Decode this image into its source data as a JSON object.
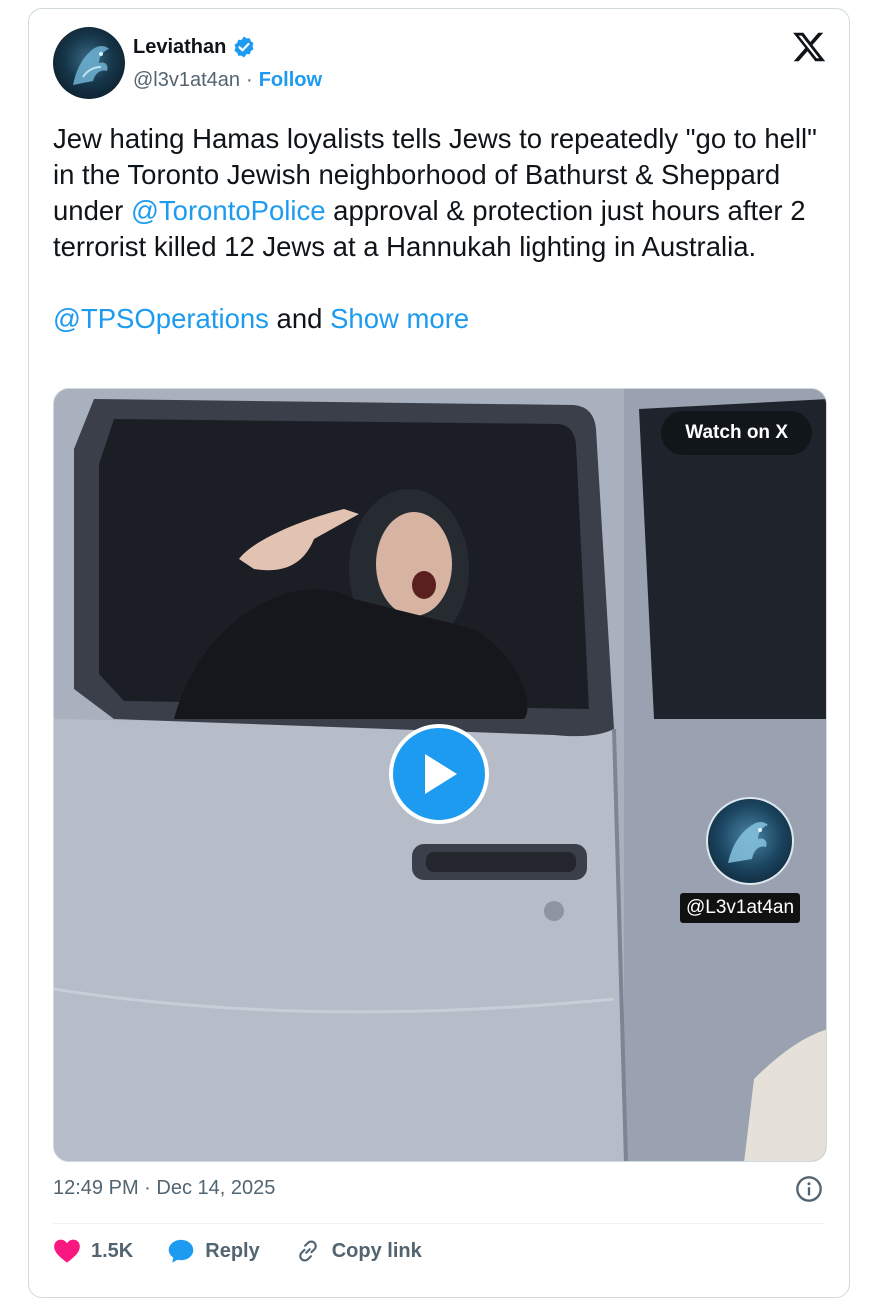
{
  "author": {
    "name": "Leviathan",
    "handle": "@l3v1at4an",
    "separator": "·",
    "follow_label": "Follow",
    "avatar_icon": "dragon-avatar-icon",
    "verified_icon": "verified-badge-icon"
  },
  "brand": {
    "logo_icon": "x-logo-icon"
  },
  "tweet": {
    "text_part1": "Jew hating Hamas loyalists tells Jews to repeatedly \"go to hell\" in the Toronto Jewish neighborhood of Bathurst & Sheppard under ",
    "mention1": "@TorontoPolice",
    "text_part2": " approval & protection just hours after 2 terrorist killed 12 Jews at a Hannukah lighting in Australia.",
    "mention2": "@TPSOperations",
    "and_text": " and ",
    "show_more": "Show more"
  },
  "media": {
    "watch_label": "Watch on X",
    "play_icon": "play-icon",
    "watermark_text": "@L3v1at4an"
  },
  "meta": {
    "time": "12:49 PM",
    "separator": " · ",
    "date": "Dec 14, 2025",
    "info_icon": "info-icon"
  },
  "actions": {
    "like_count": "1.5K",
    "reply_label": "Reply",
    "copy_label": "Copy link"
  },
  "colors": {
    "accent": "#1d9bf0",
    "like": "#f91880",
    "text": "#0f1419",
    "secondary": "#536471"
  }
}
